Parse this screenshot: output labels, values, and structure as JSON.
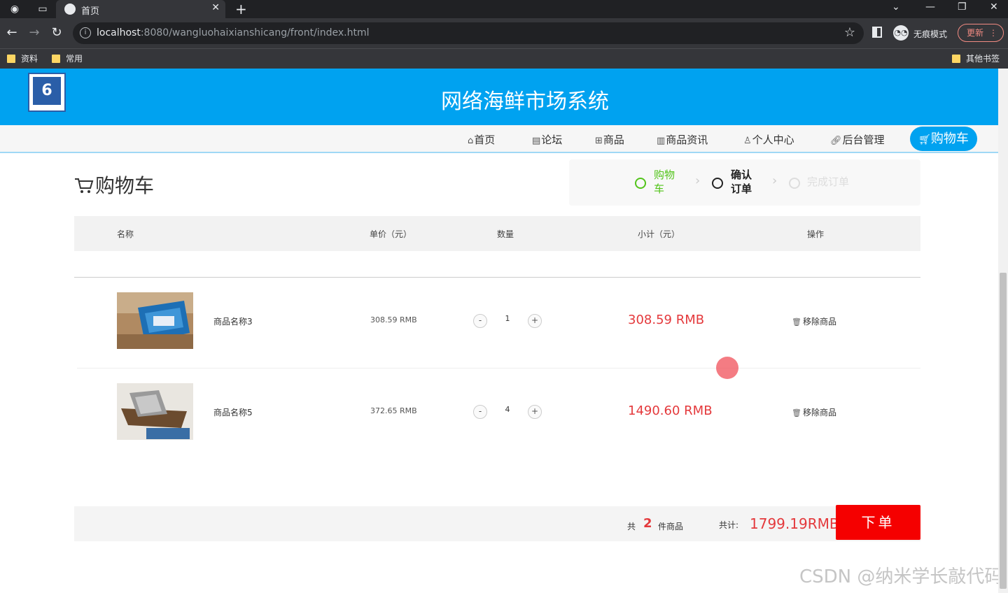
{
  "browser": {
    "tab_title": "首页",
    "url_host": "localhost",
    "url_rest": ":8080/wangluohaixianshicang/front/index.html",
    "incognito_label": "无痕模式",
    "update_label": "更新",
    "bookmarks": [
      "资料",
      "常用"
    ],
    "other_bookmarks": "其他书签"
  },
  "site": {
    "title": "网络海鲜市场系统",
    "logo_text": "6",
    "nav": [
      {
        "label": "首页",
        "icon": "home-icon"
      },
      {
        "label": "论坛",
        "icon": "forum-icon"
      },
      {
        "label": "商品",
        "icon": "goods-icon"
      },
      {
        "label": "商品资讯",
        "icon": "news-icon"
      },
      {
        "label": "个人中心",
        "icon": "user-icon"
      },
      {
        "label": "后台管理",
        "icon": "link-icon"
      }
    ],
    "nav_cart": "购物车"
  },
  "cart": {
    "heading": "购物车",
    "steps": {
      "s1": "购物车",
      "s1a": "购物",
      "s1b": "车",
      "s2a": "确认",
      "s2b": "订单",
      "s3": "完成订单"
    },
    "columns": {
      "name": "名称",
      "price": "单价（元）",
      "qty": "数量",
      "subtotal": "小计（元）",
      "action": "操作"
    },
    "items": [
      {
        "name": "商品名称3",
        "price": "308.59 RMB",
        "qty": "1",
        "subtotal": "308.59 RMB",
        "remove": "移除商品"
      },
      {
        "name": "商品名称5",
        "price": "372.65 RMB",
        "qty": "4",
        "subtotal": "1490.60 RMB",
        "remove": "移除商品"
      }
    ],
    "summary": {
      "prefix": "共",
      "count": "2",
      "suffix": "件商品",
      "total_label": "共计:",
      "total": "1799.19RMB",
      "order_button": "下单"
    }
  },
  "watermark": "CSDN @纳米学长敲代码",
  "colors": {
    "brand": "#00a2f0",
    "price_red": "#e4393c",
    "order_button": "#f50000",
    "step_done": "#52c41a"
  }
}
